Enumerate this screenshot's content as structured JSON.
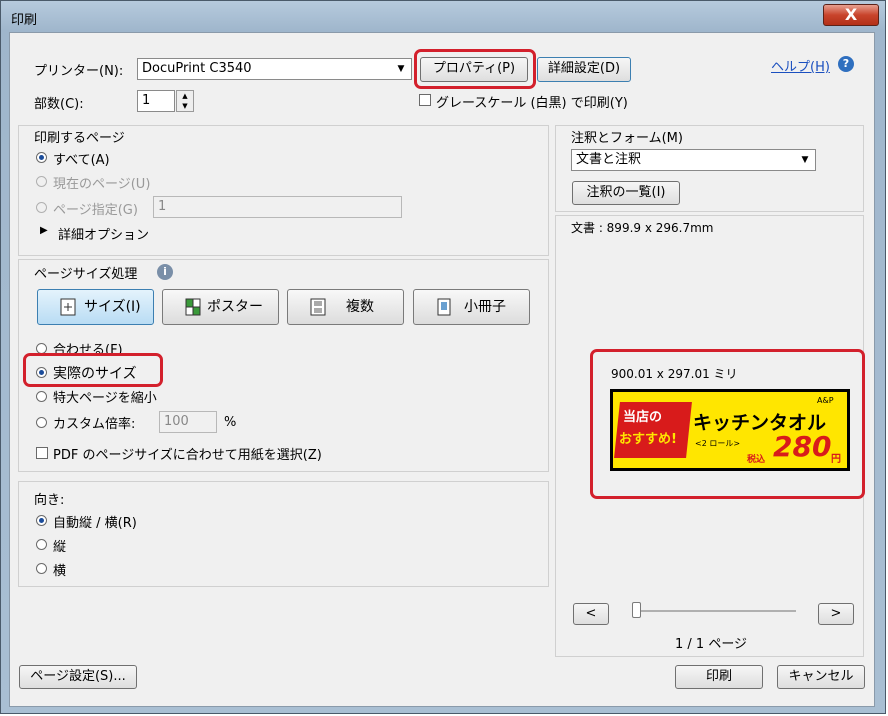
{
  "window": {
    "title": "印刷",
    "close_label": "X"
  },
  "printer": {
    "label": "プリンター(N):",
    "value": "DocuPrint C3540",
    "properties_label": "プロパティ(P)",
    "advanced_label": "詳細設定(D)",
    "help_label": "ヘルプ(H)"
  },
  "copies": {
    "label": "部数(C):",
    "value": "1"
  },
  "grayscale": {
    "label": "グレースケール (白黒) で印刷(Y)"
  },
  "pages": {
    "heading": "印刷するページ",
    "all": "すべて(A)",
    "current": "現在のページ(U)",
    "range": "ページ指定(G)",
    "range_value": "1",
    "more_options": "詳細オプション"
  },
  "sizing": {
    "heading": "ページサイズ処理",
    "buttons": [
      "サイズ(I)",
      "ポスター",
      "複数",
      "小冊子"
    ],
    "fit": "合わせる(F)",
    "actual": "実際のサイズ",
    "shrink": "特大ページを縮小",
    "custom": "カスタム倍率:",
    "custom_value": "100",
    "percent": "%",
    "choose_paper": "PDF のページサイズに合わせて用紙を選択(Z)"
  },
  "orientation": {
    "heading": "向き:",
    "auto": "自動縦 / 横(R)",
    "portrait": "縦",
    "landscape": "横"
  },
  "comments": {
    "heading": "注釈とフォーム(M)",
    "value": "文書と注釈",
    "summary_label": "注釈の一覧(I)"
  },
  "document": {
    "size": "文書 : 899.9 x 296.7mm"
  },
  "preview": {
    "size": "900.01 x 297.01 ミリ",
    "label_left_1": "当店の",
    "label_left_2": "おすすめ!",
    "label_brand": "A&P",
    "label_title": "キッチンタオル",
    "label_sub": "<2 ロール>",
    "label_tax": "税込",
    "label_price": "280",
    "label_yen": "円"
  },
  "nav": {
    "prev": "<",
    "next": ">",
    "page_info": "1 / 1 ページ"
  },
  "footer": {
    "page_setup": "ページ設定(S)...",
    "print": "印刷",
    "cancel": "キャンセル"
  }
}
